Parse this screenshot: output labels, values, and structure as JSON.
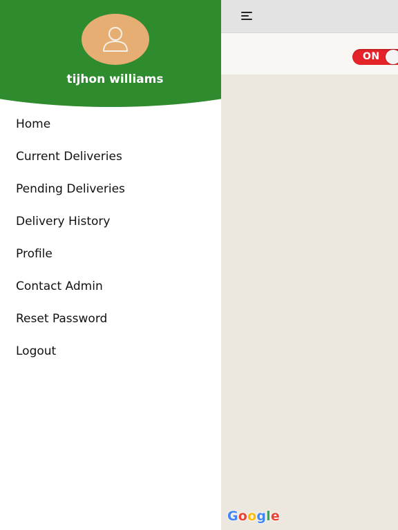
{
  "colors": {
    "drawer_header": "#2e8b2e",
    "avatar": "#e6ae72",
    "toggle_on": "#e5242a",
    "map_background": "#ece8e0"
  },
  "header": {
    "menu_icon": "hamburger-menu-icon"
  },
  "availability_toggle": {
    "label": "ON",
    "state": "on"
  },
  "drawer": {
    "avatar_icon": "user-placeholder-icon",
    "user_name": "tijhon williams",
    "menu": [
      {
        "label": "Home"
      },
      {
        "label": "Current Deliveries"
      },
      {
        "label": "Pending Deliveries"
      },
      {
        "label": "Delivery History"
      },
      {
        "label": "Profile"
      },
      {
        "label": "Contact Admin"
      },
      {
        "label": "Reset Password"
      },
      {
        "label": "Logout"
      }
    ]
  },
  "map": {
    "attribution": "Google",
    "attribution_colors": [
      "#4285f4",
      "#ea4335",
      "#fbbc05",
      "#4285f4",
      "#34a853",
      "#ea4335"
    ]
  }
}
